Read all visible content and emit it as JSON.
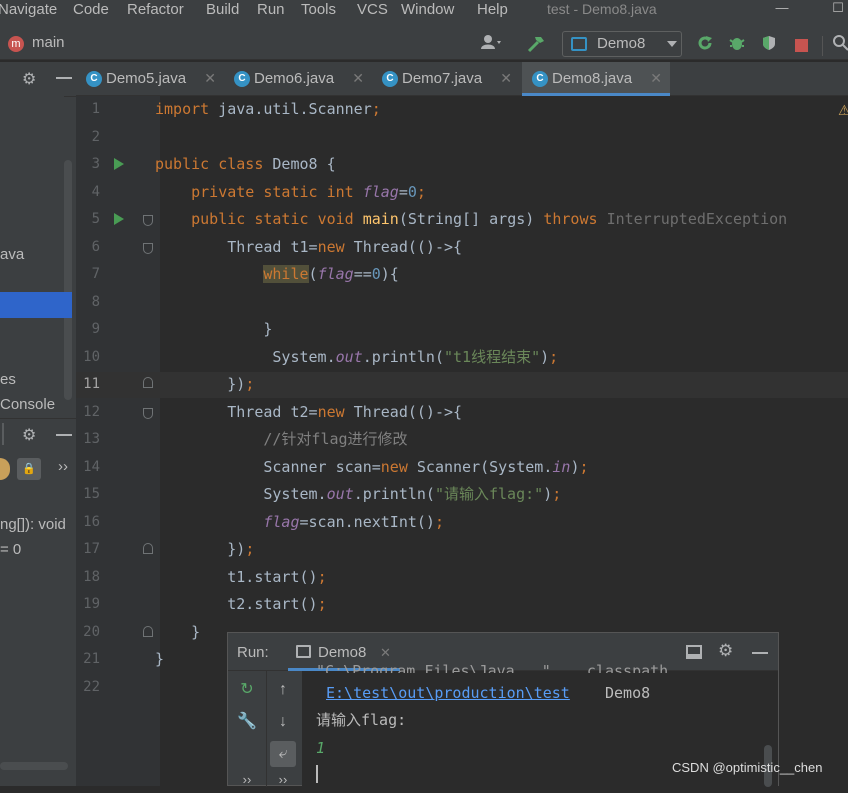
{
  "menu": {
    "items": [
      "Navigate",
      "Code",
      "Refactor",
      "Build",
      "Run",
      "Tools",
      "VCS",
      "Window",
      "Help"
    ],
    "title": "test - Demo8.java"
  },
  "navbar": {
    "branch_badge": "m",
    "branch": "main",
    "run_config": "Demo8"
  },
  "tabs": [
    {
      "label": "Demo5.java",
      "active": false
    },
    {
      "label": "Demo6.java",
      "active": false
    },
    {
      "label": "Demo7.java",
      "active": false
    },
    {
      "label": "Demo8.java",
      "active": true
    }
  ],
  "left_panel": {
    "fragments": [
      "ava",
      "es",
      "Console",
      "ng[]): void",
      "= 0"
    ]
  },
  "editor": {
    "line_numbers": [
      "1",
      "2",
      "3",
      "4",
      "5",
      "6",
      "7",
      "8",
      "9",
      "10",
      "11",
      "12",
      "13",
      "14",
      "15",
      "16",
      "17",
      "18",
      "19",
      "20",
      "21",
      "22"
    ],
    "current_line": "11",
    "lines": [
      "import java.util.Scanner;",
      "",
      "public class Demo8 {",
      "    private static int flag=0;",
      "    public static void main(String[] args) throws InterruptedException",
      "        Thread t1=new Thread(()->{",
      "            while(flag==0){",
      "",
      "            }",
      "             System.out.println(\"t1线程结束\");",
      "        });",
      "        Thread t2=new Thread(()->{",
      "            //针对flag进行修改",
      "            Scanner scan=new Scanner(System.in);",
      "            System.out.println(\"请输入flag:\");",
      "            flag=scan.nextInt();",
      "        });",
      "        t1.start();",
      "        t2.start();",
      "    }",
      "}",
      ""
    ]
  },
  "run_panel": {
    "label": "Run:",
    "tab": "Demo8",
    "output": {
      "cut_line": "\"C:\\Program Files\\Java...\" ...classpath",
      "path_link": "E:\\test\\out\\production\\test",
      "class_name": "Demo8",
      "prompt": "请输入flag:",
      "input": "1"
    }
  },
  "watermark": "CSDN @optimistic__chen",
  "colors": {
    "keyword": "#cc7832",
    "field": "#9876aa",
    "number": "#6897bb",
    "string": "#6a8759",
    "method": "#ffc66d",
    "comment": "#808080",
    "accent": "#4a88c7"
  }
}
